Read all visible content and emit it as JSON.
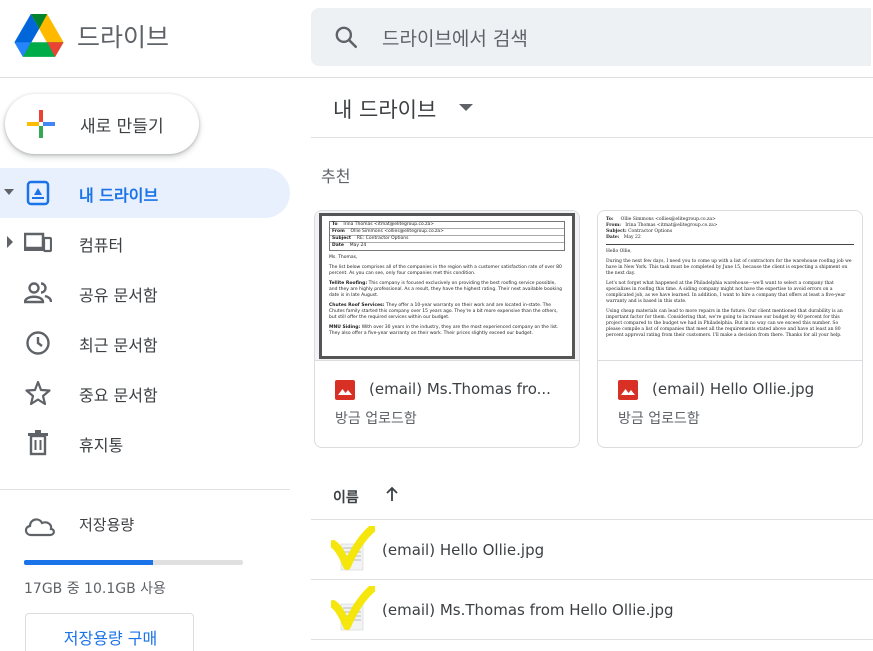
{
  "header": {
    "app_title": "드라이브",
    "search_placeholder": "드라이브에서 검색"
  },
  "sidebar": {
    "new_button_label": "새로 만들기",
    "items": [
      {
        "label": "내 드라이브",
        "icon": "my-drive-icon",
        "active": true
      },
      {
        "label": "컴퓨터",
        "icon": "computer-icon"
      },
      {
        "label": "공유 문서함",
        "icon": "shared-icon"
      },
      {
        "label": "최근 문서함",
        "icon": "recent-icon"
      },
      {
        "label": "중요 문서함",
        "icon": "star-icon"
      },
      {
        "label": "휴지통",
        "icon": "trash-icon"
      }
    ],
    "storage": {
      "label": "저장용량",
      "usage_text": "17GB 중 10.1GB 사용",
      "used_fraction": 0.59,
      "buy_label": "저장용량 구매"
    }
  },
  "main": {
    "title": "내 드라이브",
    "suggested_label": "추천",
    "cards": [
      {
        "name": "(email) Ms.Thomas fro...",
        "subtitle": "방금 업로드함",
        "preview": {
          "header": [
            [
              "To",
              "Irina Thomas <itmat@elitegroup.co.za>"
            ],
            [
              "From",
              "Ollie Simmons <ollies@elitegroup.co.za>"
            ],
            [
              "Subject",
              "RE: Contractor Options"
            ],
            [
              "Date",
              "May 24"
            ]
          ],
          "greeting": "Ms. Thomas,",
          "para1": "The list below comprises all of the companies in the region with a customer satisfaction rate of over 80 percent. As you can see, only four companies met this condition.",
          "para2_head": "Tellite Roofing:",
          "para2": "This company is focused exclusively on providing the best roofing service possible, and they are highly professional. As a result, they have the highest rating. Their next available booking date is in late August.",
          "para3_head": "Chutes Roof Services:",
          "para3": "They offer a 10-year warranty on their work and are located in-state. The Chutes family started this company over 15 years ago. They're a bit more expensive than the others, but still offer the required services within our budget.",
          "para4_head": "MNU Siding:",
          "para4": "With over 30 years in the industry, they are the most experienced company on the list. They also offer a five-year warranty on their work. Their prices slightly exceed our budget."
        }
      },
      {
        "name": "(email) Hello Ollie.jpg",
        "subtitle": "방금 업로드함",
        "preview": {
          "header": [
            [
              "To:",
              "Ollie Simmons <ollies@elitegroup.co.za>"
            ],
            [
              "From:",
              "Irina Thomas <itmat@elitegroup.co.za>"
            ],
            [
              "Subject:",
              "Contractor Options"
            ],
            [
              "Date:",
              "May 22"
            ]
          ],
          "greeting": "Hello Ollie,",
          "para1": "During the next few days, I need you to come up with a list of contractors for the warehouse roofing job we have in New York. This task must be completed by June 15, because the client is expecting a shipment on the next day.",
          "para2": "Let's not forget what happened at the Philadelphia warehouse—we'll want to select a company that specializes in roofing this time. A siding company might not have the expertise to avoid errors on a complicated job, as we have learned. In addition, I want to hire a company that offers at least a five-year warranty and is based in this state.",
          "para3": "Using cheap materials can lead to more repairs in the future. Our client mentioned that durability is an important factor for them. Considering that, we're going to increase our budget by 40 percent for this project compared to the budget we had in Philadelphia. But in no way can we exceed this number. So please compile a list of companies that meet all the requirements stated above and have at least an 80 percent approval rating from their customers. I'll make a decision from there. Thanks for all your help."
        }
      }
    ],
    "list_header": "이름",
    "files": [
      {
        "name": "(email) Hello Ollie.jpg"
      },
      {
        "name": "(email) Ms.Thomas from Hello Ollie.jpg"
      }
    ]
  },
  "colors": {
    "accent": "#1a73e8",
    "active_bg": "#e8f0fe",
    "search_bg": "#eef1f4",
    "highlight_check": "#f4e600",
    "image_icon_red": "#d93025"
  }
}
